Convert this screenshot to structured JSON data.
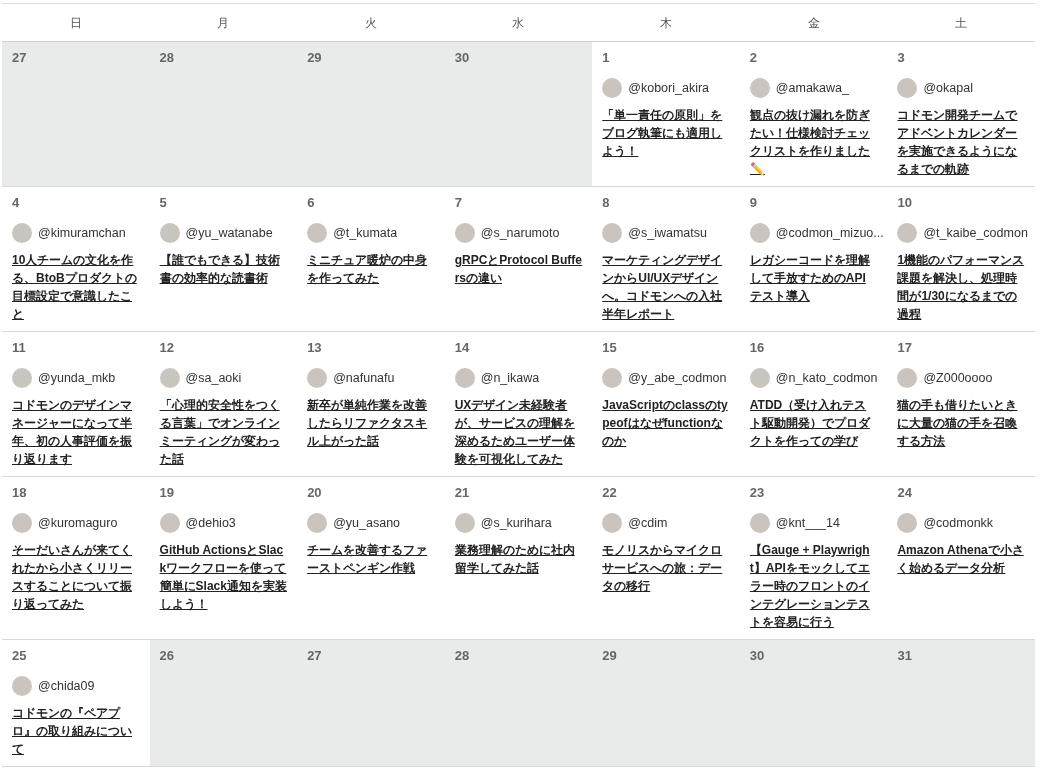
{
  "weekdays": [
    "日",
    "月",
    "火",
    "水",
    "木",
    "金",
    "土"
  ],
  "weeks": [
    [
      {
        "date": "27",
        "outside": true
      },
      {
        "date": "28",
        "outside": true
      },
      {
        "date": "29",
        "outside": true
      },
      {
        "date": "30",
        "outside": true
      },
      {
        "date": "1",
        "outside": false,
        "author": "@kobori_akira",
        "title": "「単一責任の原則」をブログ執筆にも適用しよう！"
      },
      {
        "date": "2",
        "outside": false,
        "author": "@amakawa_",
        "title": "観点の抜け漏れを防ぎたい！仕様検討チェックリストを作りました✏️"
      },
      {
        "date": "3",
        "outside": false,
        "author": "@okapal",
        "title": "コドモン開発チームでアドベントカレンダーを実施できるようになるまでの軌跡"
      }
    ],
    [
      {
        "date": "4",
        "outside": false,
        "author": "@kimuramchan",
        "title": "10人チームの文化を作る、BtoBプロダクトの目標設定で意識したこと"
      },
      {
        "date": "5",
        "outside": false,
        "author": "@yu_watanabe",
        "title": "【誰でもできる】技術書の効率的な読書術"
      },
      {
        "date": "6",
        "outside": false,
        "author": "@t_kumata",
        "title": "ミニチュア暖炉の中身を作ってみた"
      },
      {
        "date": "7",
        "outside": false,
        "author": "@s_narumoto",
        "title": "gRPCとProtocol Buffersの違い"
      },
      {
        "date": "8",
        "outside": false,
        "author": "@s_iwamatsu",
        "title": "マーケティングデザインからUI/UXデザインへ。コドモンへの入社半年レポート"
      },
      {
        "date": "9",
        "outside": false,
        "author": "@codmon_mizuo...",
        "title": "レガシーコードを理解して手放すためのAPIテスト導入"
      },
      {
        "date": "10",
        "outside": false,
        "author": "@t_kaibe_codmon",
        "title": "1機能のパフォーマンス課題を解決し、処理時間が1/30になるまでの過程"
      }
    ],
    [
      {
        "date": "11",
        "outside": false,
        "author": "@yunda_mkb",
        "title": "コドモンのデザインマネージャーになって半年、初の人事評価を振り返ります"
      },
      {
        "date": "12",
        "outside": false,
        "author": "@sa_aoki",
        "title": "「心理的安全性をつくる言葉」でオンラインミーティングが変わった話"
      },
      {
        "date": "13",
        "outside": false,
        "author": "@nafunafu",
        "title": "新卒が単純作業を改善したらリファクタスキル上がった話"
      },
      {
        "date": "14",
        "outside": false,
        "author": "@n_ikawa",
        "title": "UXデザイン未経験者が、サービスの理解を深めるためユーザー体験を可視化してみた"
      },
      {
        "date": "15",
        "outside": false,
        "author": "@y_abe_codmon",
        "title": "JavaScriptのclassのtypeofはなぜfunctionなのか"
      },
      {
        "date": "16",
        "outside": false,
        "author": "@n_kato_codmon",
        "title": "ATDD（受け入れテスト駆動開発）でプロダクトを作っての学び"
      },
      {
        "date": "17",
        "outside": false,
        "author": "@Z000oooo",
        "title": "猫の手も借りたいときに大量の猫の手を召喚する方法"
      }
    ],
    [
      {
        "date": "18",
        "outside": false,
        "author": "@kuromaguro",
        "title": "そーだいさんが来てくれたから小さくリリースすることについて振り返ってみた"
      },
      {
        "date": "19",
        "outside": false,
        "author": "@dehio3",
        "title": "GitHub ActionsとSlackワークフローを使って簡単にSlack通知を実装しよう！"
      },
      {
        "date": "20",
        "outside": false,
        "author": "@yu_asano",
        "title": "チームを改善するファーストペンギン作戦"
      },
      {
        "date": "21",
        "outside": false,
        "author": "@s_kurihara",
        "title": "業務理解のために社内留学してみた話"
      },
      {
        "date": "22",
        "outside": false,
        "author": "@cdim",
        "title": "モノリスからマイクロサービスへの旅：データの移行"
      },
      {
        "date": "23",
        "outside": false,
        "author": "@knt___14",
        "title": "【Gauge + Playwright】APIをモックしてエラー時のフロントのインテグレーションテストを容易に行う"
      },
      {
        "date": "24",
        "outside": false,
        "author": "@codmonkk",
        "title": "Amazon Athenaで小さく始めるデータ分析"
      }
    ],
    [
      {
        "date": "25",
        "outside": false,
        "author": "@chida09",
        "title": "コドモンの『ペアプロ』の取り組みについて"
      },
      {
        "date": "26",
        "outside": true
      },
      {
        "date": "27",
        "outside": true
      },
      {
        "date": "28",
        "outside": true
      },
      {
        "date": "29",
        "outside": true
      },
      {
        "date": "30",
        "outside": true
      },
      {
        "date": "31",
        "outside": true
      }
    ]
  ]
}
